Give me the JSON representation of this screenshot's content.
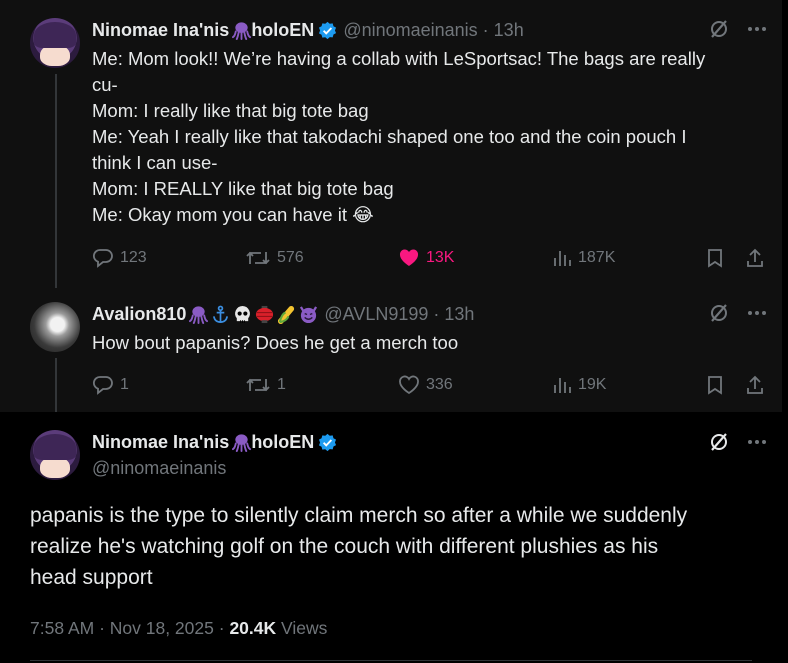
{
  "tweet1": {
    "author_name": "Ninomae Ina'nis",
    "author_suffix": "holoEN",
    "handle": "@ninomaeinanis",
    "time": "13h",
    "lines": [
      "Me: Mom look!! We’re having a collab with LeSportsac! The bags are really",
      "cu-",
      "Mom: I really like that big tote bag",
      "Me: Yeah I really like that takodachi shaped one too and the coin pouch I",
      "think I can use-",
      "Mom: I REALLY like that big tote bag",
      "Me: Okay mom you can have it 😂"
    ],
    "replies": "123",
    "reposts": "576",
    "likes": "13K",
    "views": "187K",
    "liked": true
  },
  "tweet2": {
    "author_name": "Avalion810",
    "handle": "@AVLN9199",
    "time": "13h",
    "text": "How bout papanis? Does he get a merch too",
    "replies": "1",
    "reposts": "1",
    "likes": "336",
    "views": "19K"
  },
  "tweet3": {
    "author_name": "Ninomae Ina'nis",
    "author_suffix": "holoEN",
    "handle": "@ninomaeinanis",
    "lines": [
      "papanis is the type to silently claim merch so after a while we suddenly",
      "realize he's watching golf on the couch with different plushies as his",
      "head support"
    ],
    "timestamp": "7:58 AM · Nov 18, 2025",
    "views_count": "20.4K",
    "views_label": "Views"
  },
  "colors": {
    "accent_like": "#f91880",
    "verified": "#1d9bf0",
    "muted": "#71767b",
    "text": "#e7e9ea",
    "octopus": "#8a5bc4"
  }
}
